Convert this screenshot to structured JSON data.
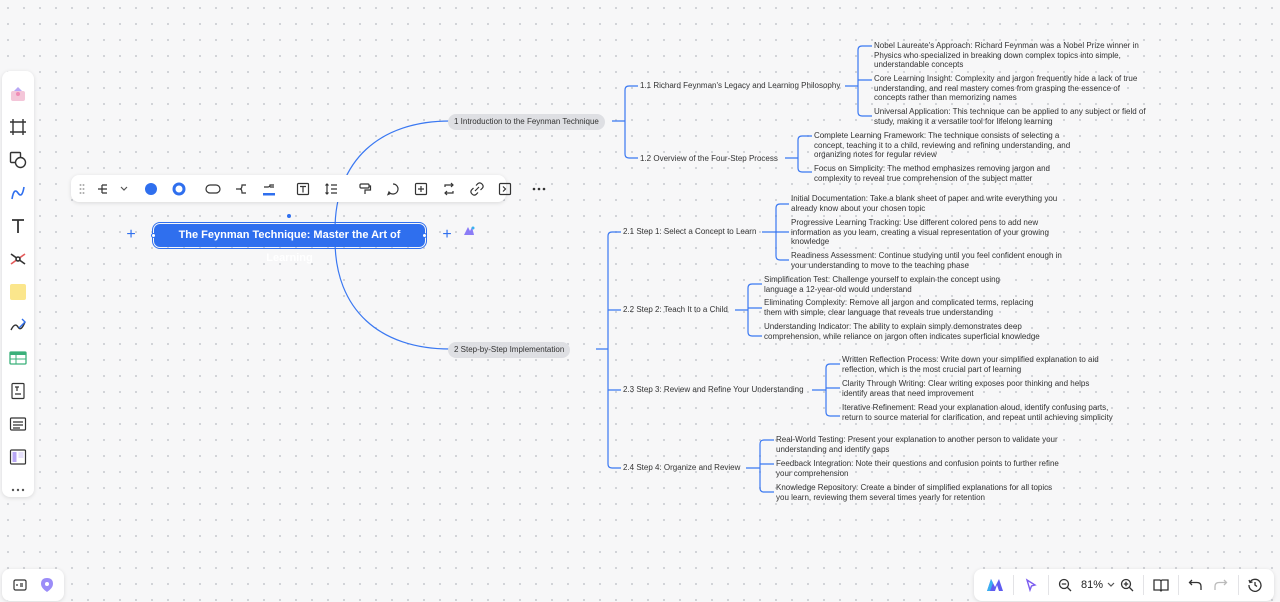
{
  "canvas": {
    "background": "#f7f7f8",
    "accent": "#2f6fee",
    "line_color": "#3a78f2"
  },
  "left_toolbar": {
    "tools": [
      {
        "name": "templates-icon"
      },
      {
        "name": "frame-icon"
      },
      {
        "name": "shapes-icon"
      },
      {
        "name": "connector-icon"
      },
      {
        "name": "text-icon"
      },
      {
        "name": "mindmap-icon"
      },
      {
        "name": "sticky-note-icon"
      },
      {
        "name": "pen-icon"
      },
      {
        "name": "table-icon"
      },
      {
        "name": "text-card-icon"
      },
      {
        "name": "list-icon"
      },
      {
        "name": "kanban-icon"
      },
      {
        "name": "more-icon"
      }
    ]
  },
  "node_toolbar": {
    "items": [
      "drag-handle-icon",
      "layout-icon",
      "chevron-down-icon",
      "fill-color-icon",
      "border-color-icon",
      "shape-icon",
      "branch-style-icon",
      "line-color-icon",
      "text-style-icon",
      "line-spacing-icon",
      "format-painter-icon",
      "comment-icon",
      "add-subtopic-icon",
      "convert-icon",
      "link-icon",
      "expand-icon",
      "more-icon"
    ]
  },
  "mindmap": {
    "root": "The Feynman Technique: Master the Art of Learning",
    "branches": [
      {
        "label": "1 Introduction to the Feynman Technique",
        "subtopics": [
          {
            "label": "1.1 Richard Feynman's Legacy and Learning Philosophy",
            "leaves": [
              "Nobel Laureate's Approach: Richard Feynman was a Nobel Prize winner in Physics who specialized in breaking down complex topics into simple, understandable concepts",
              "Core Learning Insight: Complexity and jargon frequently hide a lack of true understanding, and real mastery comes from grasping the essence of concepts rather than memorizing names",
              "Universal Application: This technique can be applied to any subject or field of study, making it a versatile tool for lifelong learning"
            ]
          },
          {
            "label": "1.2 Overview of the Four-Step Process",
            "leaves": [
              "Complete Learning Framework: The technique consists of selecting a concept, teaching it to a child, reviewing and refining understanding, and organizing notes for regular review",
              "Focus on Simplicity: The method emphasizes removing jargon and complexity to reveal true comprehension of the subject matter"
            ]
          }
        ]
      },
      {
        "label": "2 Step-by-Step Implementation",
        "subtopics": [
          {
            "label": "2.1 Step 1: Select a Concept to Learn",
            "leaves": [
              "Initial Documentation: Take a blank sheet of paper and write everything you already know about your chosen topic",
              "Progressive Learning Tracking: Use different colored pens to add new information as you learn, creating a visual representation of your growing knowledge",
              "Readiness Assessment: Continue studying until you feel confident enough in your understanding to move to the teaching phase"
            ]
          },
          {
            "label": "2.2 Step 2: Teach It to a Child",
            "leaves": [
              "Simplification Test: Challenge yourself to explain the concept using language a 12-year-old would understand",
              "Eliminating Complexity: Remove all jargon and complicated terms, replacing them with simple, clear language that reveals true understanding",
              "Understanding Indicator: The ability to explain simply demonstrates deep comprehension, while reliance on jargon often indicates superficial knowledge"
            ]
          },
          {
            "label": "2.3 Step 3: Review and Refine Your Understanding",
            "leaves": [
              "Written Reflection Process: Write down your simplified explanation to aid reflection, which is the most crucial part of learning",
              "Clarity Through Writing: Clear writing exposes poor thinking and helps identify areas that need improvement",
              "Iterative Refinement: Read your explanation aloud, identify confusing parts, return to source material for clarification, and repeat until achieving simplicity"
            ]
          },
          {
            "label": "2.4 Step 4: Organize and Review",
            "leaves": [
              "Real-World Testing: Present your explanation to another person to validate your understanding and identify gaps",
              "Feedback Integration: Note their questions and confusion points to further refine your comprehension",
              "Knowledge Repository: Create a binder of simplified explanations for all topics you learn, reviewing them several times yearly for retention"
            ]
          }
        ]
      }
    ]
  },
  "bottom_left": {
    "items": [
      "outline-icon",
      "location-icon"
    ]
  },
  "bottom_right": {
    "zoom": "81%",
    "items": [
      "ai-logo-icon",
      "select-pointer-icon",
      "zoom-out-icon",
      "zoom-in-icon",
      "book-icon",
      "undo-icon",
      "redo-icon",
      "history-icon"
    ]
  }
}
